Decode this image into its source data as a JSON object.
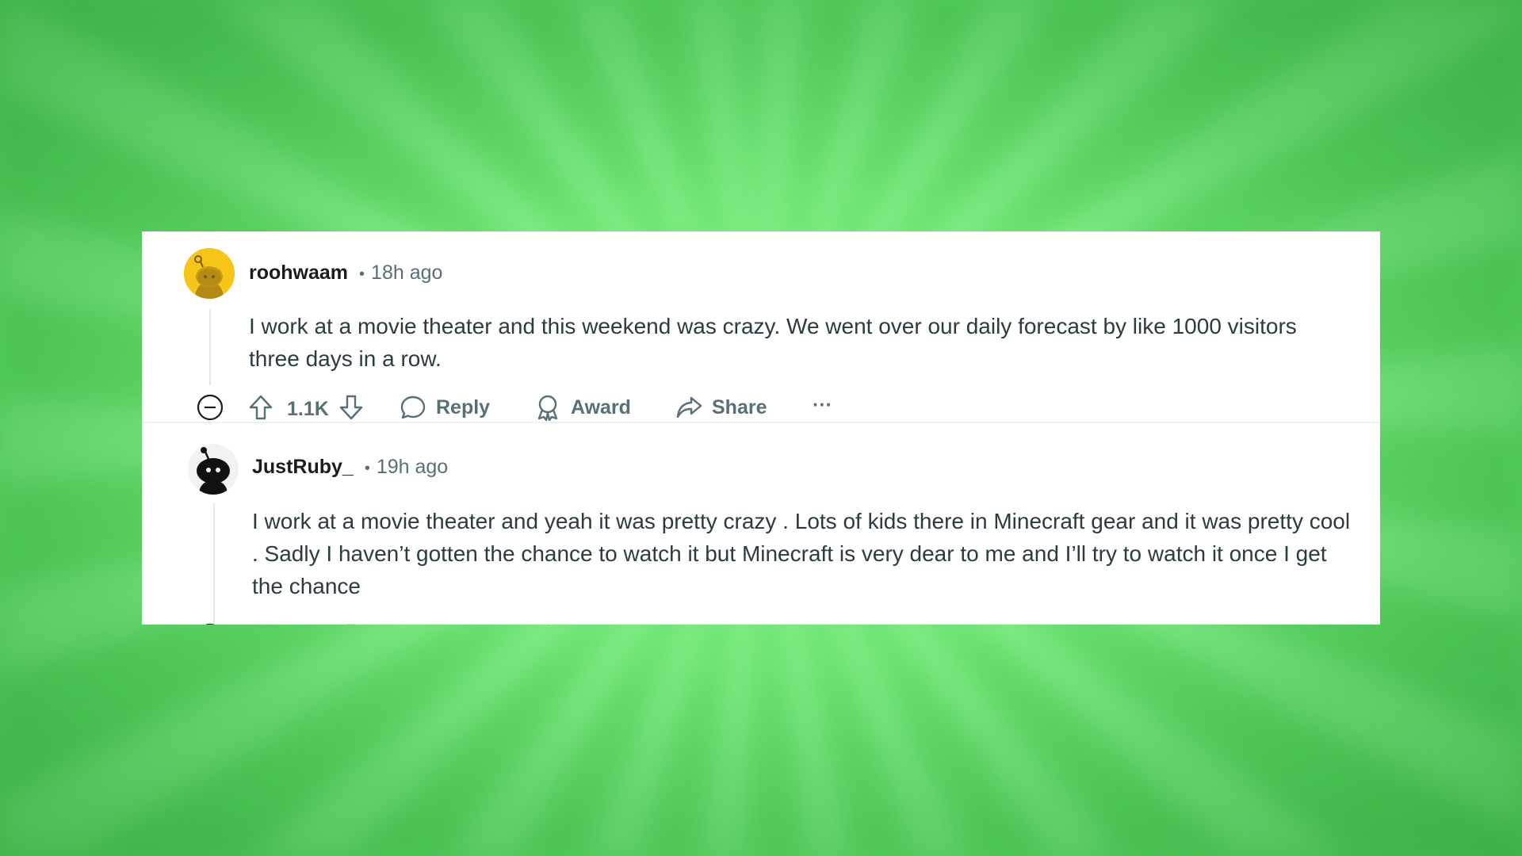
{
  "comments": [
    {
      "username": "roohwaam",
      "separator": "•",
      "time": "18h ago",
      "body": "I work at a movie theater and this weekend was crazy. We went over our daily forecast by like 1000 visitors three days in a row.",
      "score": "1.1K",
      "actions": {
        "reply": "Reply",
        "award": "Award",
        "share": "Share",
        "more": "···"
      },
      "avatar_color": "#f5c518"
    },
    {
      "username": "JustRuby_",
      "separator": "•",
      "time": "19h ago",
      "body": "I work at a movie theater and yeah it was pretty crazy . Lots of kids there in Minecraft gear and it was pretty cool . Sadly I haven’t gotten the chance to watch it but Minecraft is very dear to me and I’ll try to watch it once I get the chance",
      "avatar_color": "#000000"
    }
  ],
  "colors": {
    "background": "#74ee7b",
    "card": "#ffffff",
    "username": "#1c1c1c",
    "meta": "#576f76",
    "body": "#2a3c42"
  },
  "icons": {
    "collapse": "minus-circle-icon",
    "upvote": "arrow-up-icon",
    "downvote": "arrow-down-icon",
    "reply": "speech-bubble-icon",
    "award": "award-ribbon-icon",
    "share": "share-arrow-icon",
    "more": "ellipsis-icon"
  }
}
